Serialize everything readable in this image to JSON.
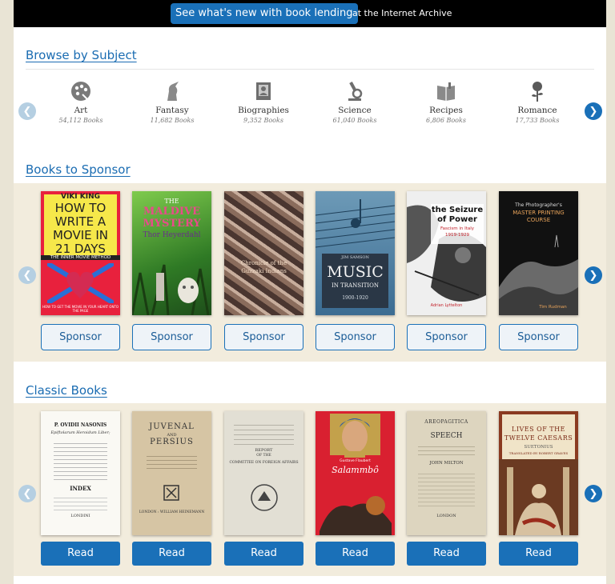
{
  "banner": {
    "button_label": "See what's new with book lending",
    "suffix": "at the Internet Archive"
  },
  "browse": {
    "heading": "Browse by Subject",
    "subjects": [
      {
        "name": "Art",
        "count": "54,112 Books",
        "icon": "palette-icon"
      },
      {
        "name": "Fantasy",
        "count": "11,682 Books",
        "icon": "unicorn-icon"
      },
      {
        "name": "Biographies",
        "count": "9,352 Books",
        "icon": "portrait-icon"
      },
      {
        "name": "Science",
        "count": "61,040 Books",
        "icon": "microscope-icon"
      },
      {
        "name": "Recipes",
        "count": "6,806 Books",
        "icon": "recipe-book-icon"
      },
      {
        "name": "Romance",
        "count": "17,733 Books",
        "icon": "rose-icon"
      }
    ]
  },
  "sponsor": {
    "heading": "Books to Sponsor",
    "button_label": "Sponsor",
    "books": [
      {
        "l1": "VIKI KING",
        "l2": "HOW TO",
        "l3": "WRITE A",
        "l4": "MOVIE IN",
        "l5": "21 DAYS",
        "l6": "THE INNER MOVIE METHOD",
        "foot": "HOW TO GET THE MOVIE IN YOUR HEART ONTO THE PAGE"
      },
      {
        "l1": "THE",
        "l2": "MALDIVE",
        "l3": "MYSTERY",
        "l4": "Thor Heyerdahl"
      },
      {
        "l1": "Chronicle of the",
        "l2": "Guzzaki Indians"
      },
      {
        "l1": "JIM SAMSON",
        "l2": "MUSIC",
        "l3": "IN TRANSITION",
        "l4": "1900-1920"
      },
      {
        "l1": "the Seizure",
        "l2": "of Power",
        "l3": "Fascism in Italy",
        "l4": "1919-1929",
        "l5": "Adrian Lyttelton"
      },
      {
        "l1": "The Photographer's",
        "l2": "MASTER PRINTING",
        "l3": "COURSE",
        "l4": "Tim Rudman"
      }
    ]
  },
  "classic": {
    "heading": "Classic Books",
    "button_label": "Read",
    "books": [
      {
        "l1": "P. OVIDII NASONIS",
        "l2": "Epiftolarum Heroidum Liber;",
        "l3": "INDEX",
        "l4": "LONDINI"
      },
      {
        "l1": "JUVENAL",
        "l2": "AND",
        "l3": "PERSIUS",
        "l4": "LONDON : WILLIAM HEINEMANN"
      },
      {
        "l1": "REPORT",
        "l2": "OF THE",
        "l3": "COMMITTEE ON FOREIGN AFFAIRS"
      },
      {
        "l1": "Gustave Flaubert",
        "l2": "Salammbô"
      },
      {
        "l1": "AREOPAGITICA",
        "l2": "SPEECH",
        "l3": "JOHN MILTON",
        "l4": "LONDON"
      },
      {
        "l1": "LIVES OF THE",
        "l2": "TWELVE CAESARS",
        "l3": "SUETONIUS",
        "l4": "TRANSLATED BY ROBERT GRAVES"
      }
    ]
  },
  "colors": {
    "accent": "#1a70b8",
    "band": "#f2ecdd",
    "page_bg": "#e9e4d5"
  }
}
